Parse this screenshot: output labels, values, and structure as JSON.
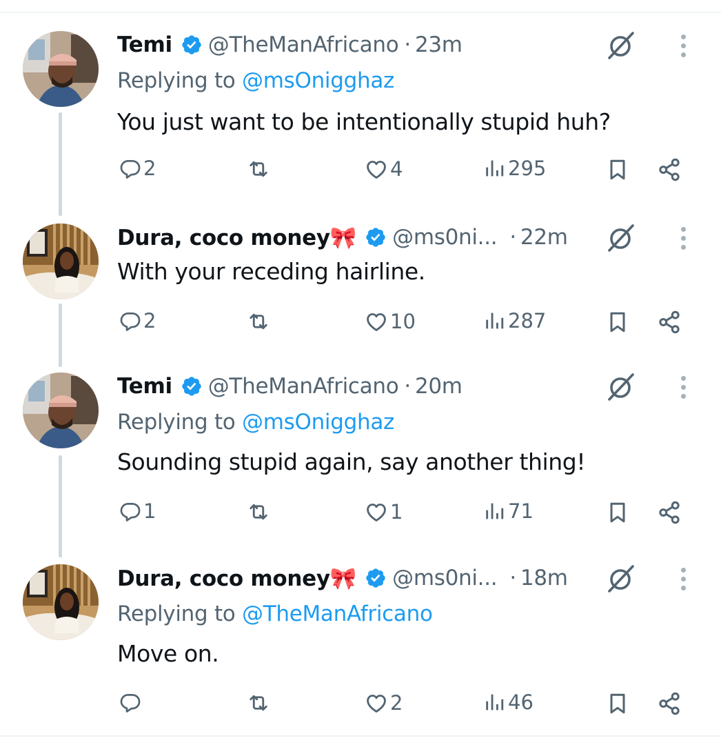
{
  "tweets": [
    {
      "name": "Temi",
      "handle": "@TheManAfricano",
      "dot": "·",
      "time": "23m",
      "replying_prefix": "Replying to ",
      "replying_to": "@msOnigghaz",
      "text": "You just want to be intentionally stupid huh?",
      "replies": "2",
      "likes": "4",
      "views": "295",
      "avatar": "man-avatar"
    },
    {
      "name": "Dura, coco money🎀",
      "handle": "@ms0ni...",
      "dot": "·",
      "time": "22m",
      "text": "With your receding hairline.",
      "replies": "2",
      "likes": "10",
      "views": "287",
      "avatar": "woman-avatar"
    },
    {
      "name": "Temi",
      "handle": "@TheManAfricano",
      "dot": "·",
      "time": "20m",
      "replying_prefix": "Replying to ",
      "replying_to": "@msOnigghaz",
      "text": "Sounding stupid again, say another thing!",
      "replies": "1",
      "likes": "1",
      "views": "71",
      "avatar": "man-avatar"
    },
    {
      "name": "Dura, coco money🎀",
      "handle": "@ms0ni...",
      "dot": "·",
      "time": "18m",
      "replying_prefix": "Replying to ",
      "replying_to": "@TheManAfricano",
      "text": "Move on.",
      "replies": "",
      "likes": "2",
      "views": "46",
      "avatar": "woman-avatar"
    }
  ],
  "icons": {
    "verified": "verified-badge-icon",
    "grok": "grok-icon",
    "more": "more-icon",
    "reply": "reply-icon",
    "retweet": "retweet-icon",
    "like": "like-icon",
    "views": "views-icon",
    "bookmark": "bookmark-icon",
    "share": "share-icon"
  },
  "colors": {
    "accent": "#1d9bf0",
    "text": "#0f1419",
    "secondary": "#536471",
    "thread_line": "#cfd9de"
  }
}
